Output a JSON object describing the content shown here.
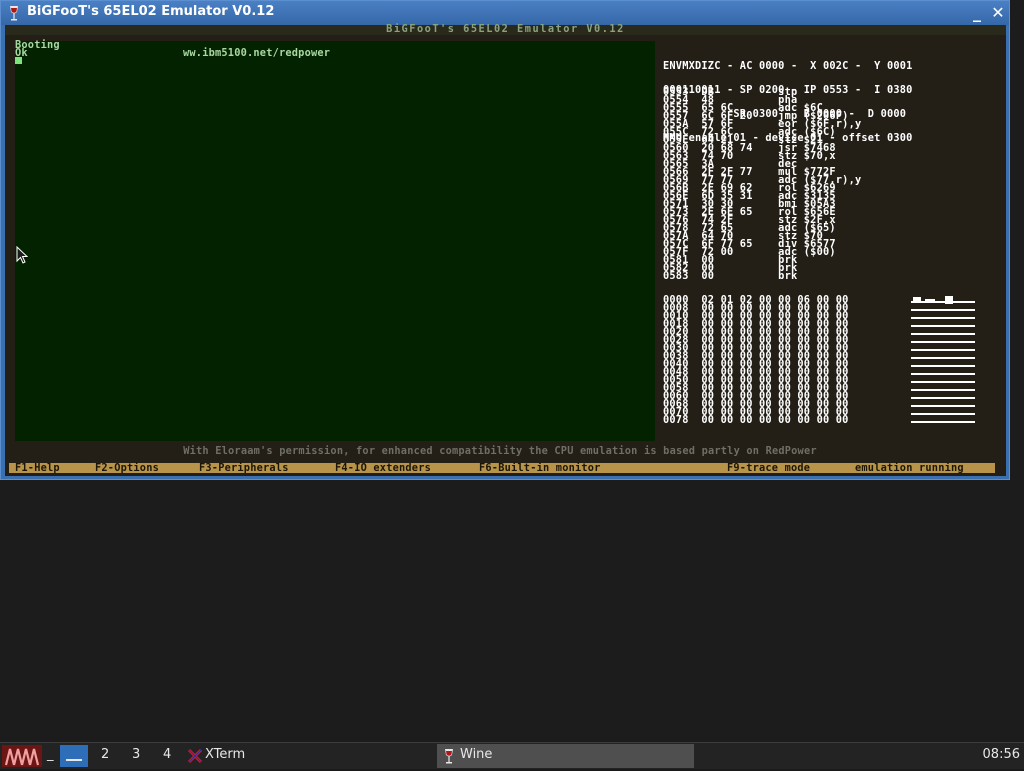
{
  "window": {
    "title": "BiGFooT's 65EL02 Emulator V0.12",
    "minimize_label": "_",
    "close_label": "✕"
  },
  "emulator": {
    "banner": "BiGFooT's 65EL02 Emulator V0.12",
    "screen_lines": [
      "Booting",
      "Ok"
    ],
    "url": "ww.ibm5100.net/redpower",
    "registers": [
      "ENVMXDIZC - AC 0000 -  X 002C -  Y 0001",
      "000110011 - SP 0200 - IP 0553 -  I 0380",
      "           SR 0300 -  B 0000 -  D 0000",
      "MMU enable 01 - device 01 - offset 0300"
    ],
    "disassembly": [
      "0553  DB          stp",
      "0554  48          pha",
      "0555  65 6C       adc $6C",
      "0557  6C 6F 20    jmp ($206F)",
      "055A  57 6F       eor ($6F,r),y",
      "055C  72 6C       adc ($6C)",
      "055E  64 21       stz $21",
      "0560  20 68 74    jsr $7468",
      "0563  74 70       stz $70,x",
      "0565  3A          dec",
      "0566  2F 2F 77    mul $772F",
      "0569  77 77       adc ($77,r),y",
      "056B  2E 69 62    rol $6269",
      "056E  6D 35 31    adc $3135",
      "0571  30 30       bmi $05A3",
      "0573  2E 6E 65    rol $656E",
      "0576  74 2F       stz $2F,x",
      "0578  72 65       adc ($65)",
      "057A  64 70       stz $70",
      "057C  6F 77 65    div $6577",
      "057F  72 00       adc ($00)",
      "0581  00          brk",
      "0582  00          brk",
      "0583  00          brk"
    ],
    "hexdump": [
      "0000  02 01 02 00 00 06 00 00",
      "0008  00 00 00 00 00 00 00 00",
      "0010  00 00 00 00 00 00 00 00",
      "0018  00 00 00 00 00 00 00 00",
      "0020  00 00 00 00 00 00 00 00",
      "0028  00 00 00 00 00 00 00 00",
      "0030  00 00 00 00 00 00 00 00",
      "0038  00 00 00 00 00 00 00 00",
      "0040  00 00 00 00 00 00 00 00",
      "0048  00 00 00 00 00 00 00 00",
      "0050  00 00 00 00 00 00 00 00",
      "0058  00 00 00 00 00 00 00 00",
      "0060  00 00 00 00 00 00 00 00",
      "0068  00 00 00 00 00 00 00 00",
      "0070  00 00 00 00 00 00 00 00",
      "0078  00 00 00 00 00 00 00 00"
    ],
    "permission": "With Eloraam's permission, for enhanced compatibility the CPU emulation is based partly on RedPower",
    "function_keys": [
      "F1-Help",
      "F2-Options",
      "F3-Peripherals",
      "F4-IO extenders",
      "F6-Built-in monitor",
      "F9-trace mode",
      "emulation running"
    ]
  },
  "taskbar": {
    "minimized_label": "_",
    "workspaces": [
      "2",
      "3",
      "4"
    ],
    "tasks": [
      {
        "label": "XTerm",
        "icon": "xterm-icon"
      },
      {
        "label": "Wine",
        "icon": "wine-glass-icon"
      }
    ],
    "clock": "08:56"
  },
  "colors": {
    "screen_bg": "#032300",
    "screen_text": "#a9d8a2",
    "fnbar_bg": "#b8944a",
    "title_bg": "#3567a8"
  }
}
